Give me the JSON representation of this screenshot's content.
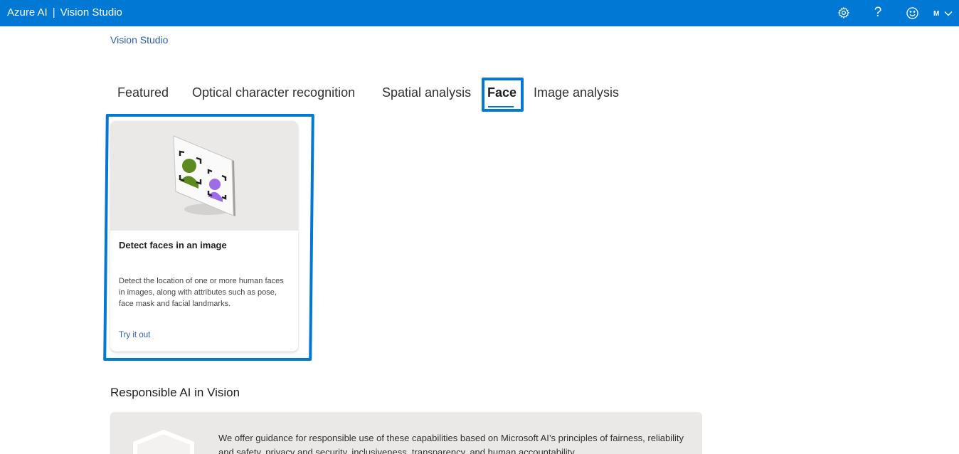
{
  "topbar": {
    "brand_left": "Azure AI",
    "separator": "|",
    "brand_right": "Vision Studio",
    "account_initial": "M",
    "icons": [
      "gear-icon",
      "question-icon",
      "smiley-icon",
      "chevron-down-icon"
    ]
  },
  "breadcrumb": {
    "label": "Vision Studio"
  },
  "tabs": [
    {
      "label": "Featured"
    },
    {
      "label": "Optical character recognition"
    },
    {
      "label": "Spatial analysis"
    },
    {
      "label": "Face",
      "selected": true
    },
    {
      "label": "Image analysis"
    }
  ],
  "card": {
    "title": "Detect faces in an image",
    "description": "Detect the location of one or more human faces in images, along with attributes such as pose, face mask and facial landmarks.",
    "link": "Try it out"
  },
  "responsible_ai": {
    "heading": "Responsible AI in Vision",
    "text": "We offer guidance for responsible use of these capabilities based on Microsoft AI’s principles of fairness, reliability and safety, privacy and security, inclusiveness, transparency, and human accountability."
  },
  "colors": {
    "accent": "#0078d4",
    "link": "#2b5fae",
    "panel_bg": "#ebe9e7",
    "face_green": "#5c8a1e",
    "face_purple": "#9d6ce6"
  }
}
